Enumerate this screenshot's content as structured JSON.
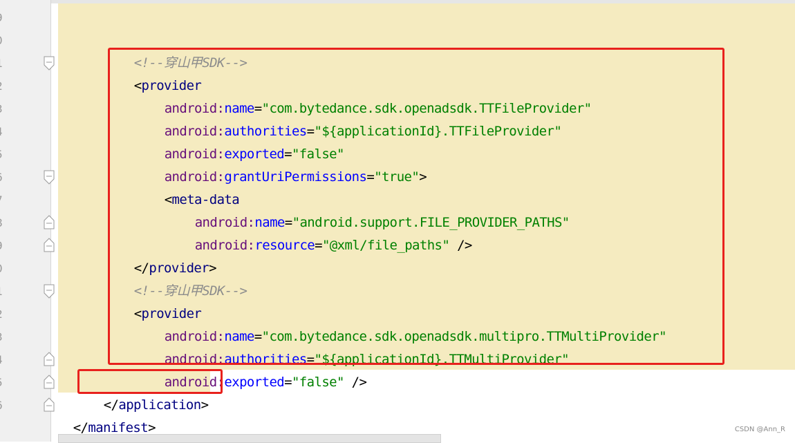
{
  "gutter": {
    "line_numbers": [
      "9",
      "0",
      "1",
      "2",
      "3",
      "4",
      "5",
      "6",
      "7",
      "8",
      "9",
      "0",
      "1",
      "2",
      "3",
      "4",
      "5",
      "6"
    ]
  },
  "code": {
    "l0": "",
    "l1_comment": "<!--穿山甲SDK-->",
    "l2_open": "<",
    "l2_tag": "provider",
    "l3_ns": "android:",
    "l3_attr": "name",
    "l3_eq": "=",
    "l3_val": "\"com.bytedance.sdk.openadsdk.TTFileProvider\"",
    "l4_ns": "android:",
    "l4_attr": "authorities",
    "l4_eq": "=",
    "l4_val": "\"${applicationId}.TTFileProvider\"",
    "l5_ns": "android:",
    "l5_attr": "exported",
    "l5_eq": "=",
    "l5_val": "\"false\"",
    "l6_ns": "android:",
    "l6_attr": "grantUriPermissions",
    "l6_eq": "=",
    "l6_val": "\"true\"",
    "l6_close": ">",
    "l7_open": "<",
    "l7_tag": "meta-data",
    "l8_ns": "android:",
    "l8_attr": "name",
    "l8_eq": "=",
    "l8_val": "\"android.support.FILE_PROVIDER_PATHS\"",
    "l9_ns": "android:",
    "l9_attr": "resource",
    "l9_eq": "=",
    "l9_val": "\"@xml/file_paths\"",
    "l9_close": " />",
    "l10_open": "</",
    "l10_tag": "provider",
    "l10_close": ">",
    "l11_comment": "<!--穿山甲SDK-->",
    "l12_open": "<",
    "l12_tag": "provider",
    "l13_ns": "android:",
    "l13_attr": "name",
    "l13_eq": "=",
    "l13_val": "\"com.bytedance.sdk.openadsdk.multipro.TTMultiProvider\"",
    "l14_ns": "android:",
    "l14_attr": "authorities",
    "l14_eq": "=",
    "l14_val": "\"${applicationId}.TTMultiProvider\"",
    "l15_ns": "android:",
    "l15_attr": "exported",
    "l15_eq": "=",
    "l15_val": "\"false\"",
    "l15_close": " />",
    "l16_open": "</",
    "l16_tag": "application",
    "l16_close": ">",
    "l17_open": "</",
    "l17_tag": "manifest",
    "l17_close": ">"
  },
  "colors": {
    "highlight": "#f5ebc0",
    "annotation_box": "#e8211d"
  },
  "watermark": "CSDN @Ann_R"
}
